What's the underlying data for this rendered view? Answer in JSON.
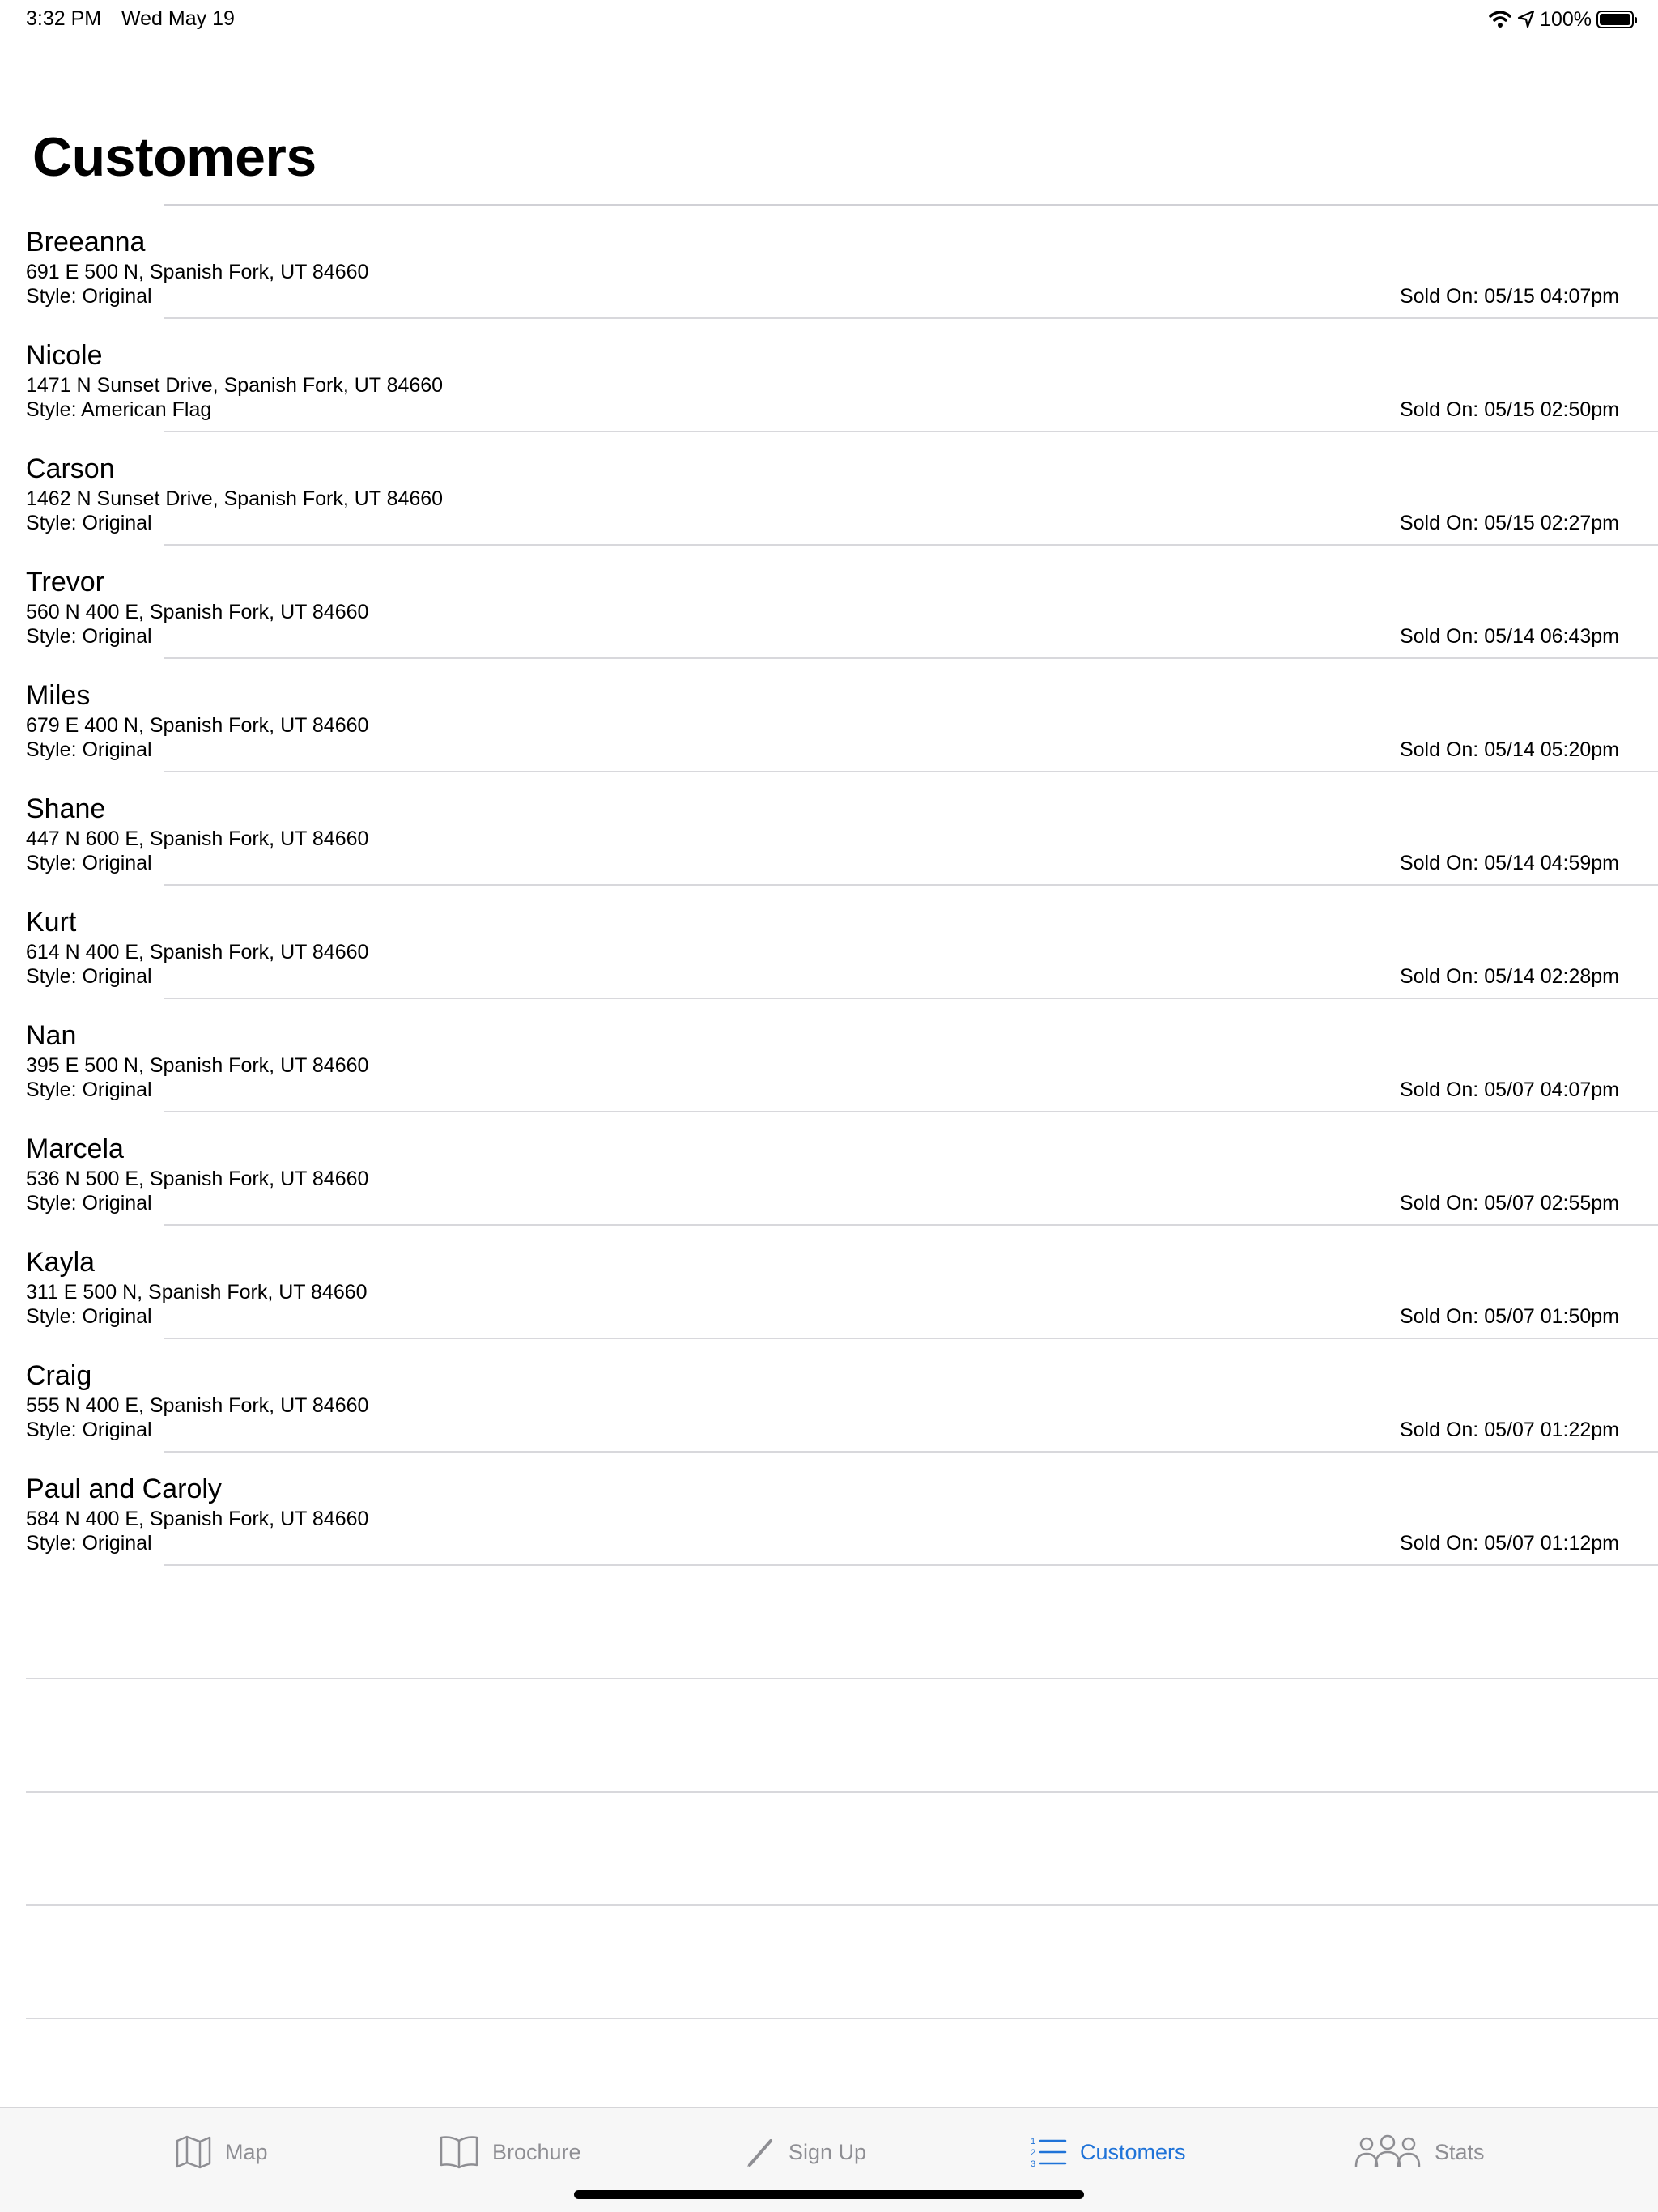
{
  "status_bar": {
    "time": "3:32 PM",
    "date": "Wed May 19",
    "battery": "100%"
  },
  "page": {
    "title": "Customers"
  },
  "customers": [
    {
      "name": "Breeanna",
      "address": "691 E 500 N, Spanish Fork, UT 84660",
      "style": "Style: Original",
      "sold": "Sold On: 05/15 04:07pm"
    },
    {
      "name": "Nicole",
      "address": "1471 N Sunset Drive, Spanish Fork, UT 84660",
      "style": "Style: American Flag",
      "sold": "Sold On: 05/15 02:50pm"
    },
    {
      "name": "Carson",
      "address": "1462 N Sunset Drive, Spanish Fork, UT 84660",
      "style": "Style: Original",
      "sold": "Sold On: 05/15 02:27pm"
    },
    {
      "name": "Trevor",
      "address": "560 N 400 E, Spanish Fork, UT 84660",
      "style": "Style: Original",
      "sold": "Sold On: 05/14 06:43pm"
    },
    {
      "name": "Miles",
      "address": "679 E 400 N, Spanish Fork, UT 84660",
      "style": "Style: Original",
      "sold": "Sold On: 05/14 05:20pm"
    },
    {
      "name": "Shane",
      "address": "447 N 600 E, Spanish Fork, UT 84660",
      "style": "Style: Original",
      "sold": "Sold On: 05/14 04:59pm"
    },
    {
      "name": "Kurt",
      "address": "614 N 400 E, Spanish Fork, UT 84660",
      "style": "Style: Original",
      "sold": "Sold On: 05/14 02:28pm"
    },
    {
      "name": "Nan",
      "address": "395 E 500 N, Spanish Fork, UT 84660",
      "style": "Style: Original",
      "sold": "Sold On: 05/07 04:07pm"
    },
    {
      "name": "Marcela",
      "address": "536 N 500 E, Spanish Fork, UT 84660",
      "style": "Style: Original",
      "sold": "Sold On: 05/07 02:55pm"
    },
    {
      "name": "Kayla",
      "address": "311 E 500 N, Spanish Fork, UT 84660",
      "style": "Style: Original",
      "sold": "Sold On: 05/07 01:50pm"
    },
    {
      "name": "Craig",
      "address": "555 N 400 E, Spanish Fork, UT 84660",
      "style": "Style: Original",
      "sold": "Sold On: 05/07 01:22pm"
    },
    {
      "name": "Paul and Caroly",
      "address": "584 N 400 E, Spanish Fork, UT 84660",
      "style": "Style: Original",
      "sold": "Sold On: 05/07 01:12pm"
    }
  ],
  "tab_bar": {
    "tabs": [
      {
        "label": "Map",
        "icon": "map-icon"
      },
      {
        "label": "Brochure",
        "icon": "book-icon"
      },
      {
        "label": "Sign Up",
        "icon": "pencil-icon"
      },
      {
        "label": "Customers",
        "icon": "numbered-list-icon"
      },
      {
        "label": "Stats",
        "icon": "people-icon"
      }
    ],
    "active_tab": "Customers",
    "active_color": "#1f73d8",
    "inactive_color": "#8e8e93"
  }
}
